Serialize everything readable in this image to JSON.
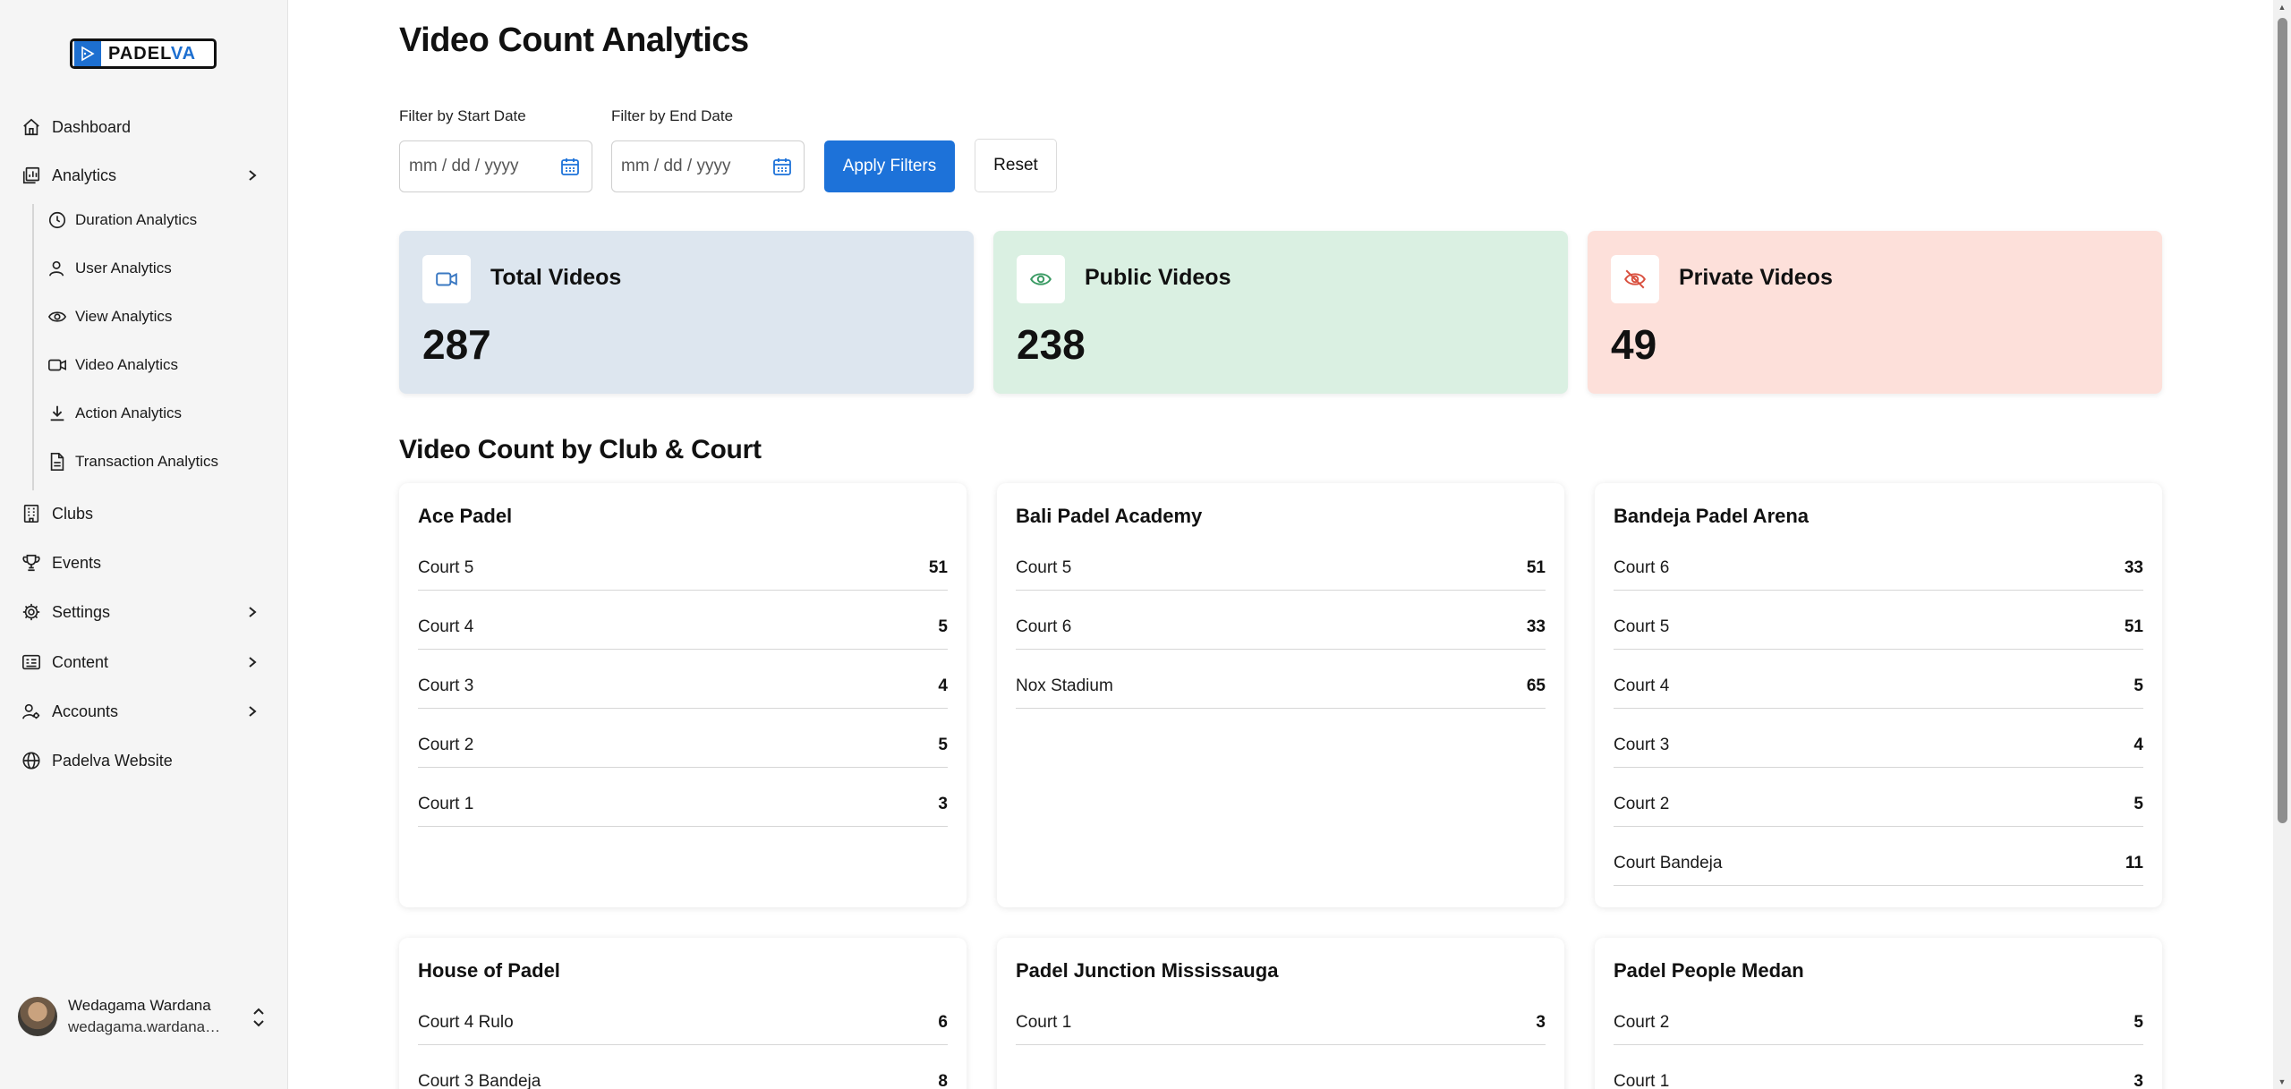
{
  "sidebar": {
    "logo": {
      "word_main": "PADEL",
      "word_accent": "VA"
    },
    "items": [
      {
        "label": "Dashboard",
        "icon": "home-icon"
      },
      {
        "label": "Analytics",
        "icon": "analytics-icon"
      },
      {
        "label": "Clubs",
        "icon": "building-icon"
      },
      {
        "label": "Events",
        "icon": "trophy-icon"
      },
      {
        "label": "Settings",
        "icon": "gear-icon"
      },
      {
        "label": "Content",
        "icon": "content-icon"
      },
      {
        "label": "Accounts",
        "icon": "accounts-icon"
      },
      {
        "label": "Padelva Website",
        "icon": "globe-icon"
      }
    ],
    "analytics_sub": [
      {
        "label": "Duration Analytics",
        "icon": "clock-icon"
      },
      {
        "label": "User Analytics",
        "icon": "user-icon"
      },
      {
        "label": "View Analytics",
        "icon": "eye-icon"
      },
      {
        "label": "Video Analytics",
        "icon": "video-icon"
      },
      {
        "label": "Action Analytics",
        "icon": "download-icon"
      },
      {
        "label": "Transaction Analytics",
        "icon": "document-icon"
      }
    ],
    "user": {
      "name": "Wedagama Wardana",
      "email": "wedagama.wardana@i..."
    }
  },
  "page": {
    "title": "Video Count Analytics",
    "filters": {
      "start_label": "Filter by Start Date",
      "end_label": "Filter by End Date",
      "date_placeholder": "mm / dd / yyyy",
      "apply_label": "Apply Filters",
      "reset_label": "Reset"
    },
    "stats": [
      {
        "title": "Total Videos",
        "value": "287",
        "bg": "#dde6ef",
        "icon": "video-camera-icon",
        "icon_color": "#3a78c2"
      },
      {
        "title": "Public Videos",
        "value": "238",
        "bg": "#daf0e2",
        "icon": "eye-icon",
        "icon_color": "#3a9a63"
      },
      {
        "title": "Private Videos",
        "value": "49",
        "bg": "#fde0da",
        "icon": "eye-off-icon",
        "icon_color": "#d9503f"
      }
    ],
    "section_title": "Video Count by Club & Court",
    "clubs": [
      {
        "name": "Ace Padel",
        "courts": [
          {
            "name": "Court 5",
            "count": "51"
          },
          {
            "name": "Court 4",
            "count": "5"
          },
          {
            "name": "Court 3",
            "count": "4"
          },
          {
            "name": "Court 2",
            "count": "5"
          },
          {
            "name": "Court 1",
            "count": "3"
          }
        ]
      },
      {
        "name": "Bali Padel Academy",
        "courts": [
          {
            "name": "Court 5",
            "count": "51"
          },
          {
            "name": "Court 6",
            "count": "33"
          },
          {
            "name": "Nox Stadium",
            "count": "65"
          }
        ]
      },
      {
        "name": "Bandeja Padel Arena",
        "courts": [
          {
            "name": "Court 6",
            "count": "33"
          },
          {
            "name": "Court 5",
            "count": "51"
          },
          {
            "name": "Court 4",
            "count": "5"
          },
          {
            "name": "Court 3",
            "count": "4"
          },
          {
            "name": "Court 2",
            "count": "5"
          },
          {
            "name": "Court Bandeja",
            "count": "11"
          }
        ]
      },
      {
        "name": "House of Padel",
        "courts": [
          {
            "name": "Court 4 Rulo",
            "count": "6"
          },
          {
            "name": "Court 3 Bandeja",
            "count": "8"
          }
        ]
      },
      {
        "name": "Padel Junction Mississauga",
        "courts": [
          {
            "name": "Court 1",
            "count": "3"
          }
        ]
      },
      {
        "name": "Padel People Medan",
        "courts": [
          {
            "name": "Court 2",
            "count": "5"
          },
          {
            "name": "Court 1",
            "count": "3"
          }
        ]
      }
    ]
  }
}
